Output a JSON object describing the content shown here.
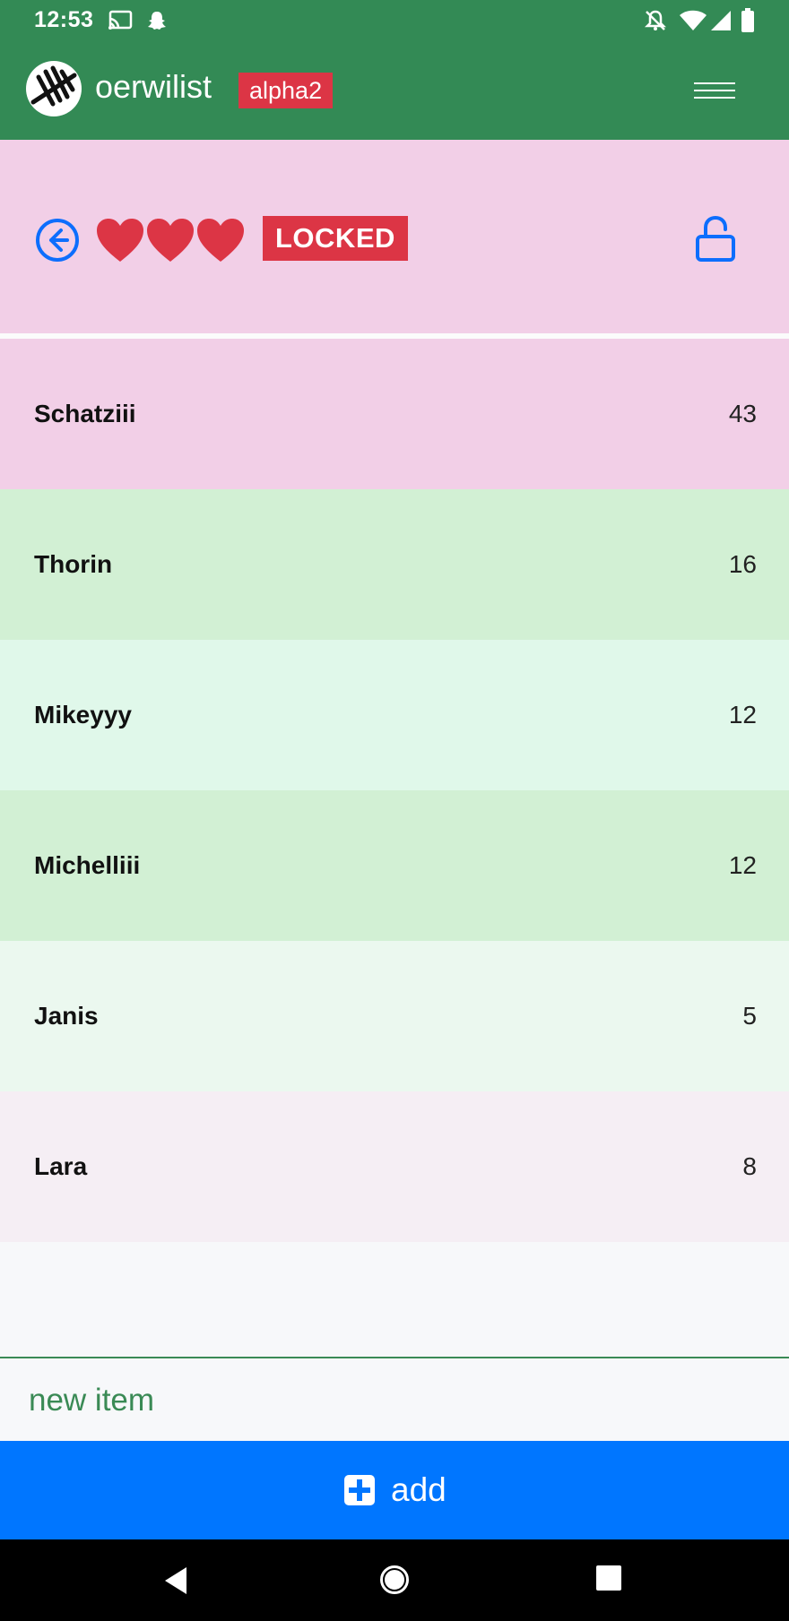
{
  "status_bar": {
    "time": "12:53",
    "icons": [
      "cast-icon",
      "snapchat-icon",
      "notifications-off-icon",
      "wifi-icon",
      "signal-icon",
      "battery-icon"
    ]
  },
  "header": {
    "title": "oerwilist",
    "badge": "alpha2",
    "background_color": "#338a55"
  },
  "list_header": {
    "hearts_count": 3,
    "locked_label": "LOCKED",
    "background_color": "#f2cfe7"
  },
  "items": [
    {
      "name": "Schatziii",
      "count": "43",
      "color": "#f2cfe7"
    },
    {
      "name": "Thorin",
      "count": "16",
      "color": "#d2f0d4"
    },
    {
      "name": "Mikeyyy",
      "count": "12",
      "color": "#e0f8ea"
    },
    {
      "name": "Michelliii",
      "count": "12",
      "color": "#d2f0d4"
    },
    {
      "name": "Janis",
      "count": "5",
      "color": "#ebf8ef"
    },
    {
      "name": "Lara",
      "count": "8",
      "color": "#f5eef4"
    }
  ],
  "input": {
    "placeholder": "new item"
  },
  "add_button": {
    "label": "add",
    "color": "#0076ff"
  }
}
